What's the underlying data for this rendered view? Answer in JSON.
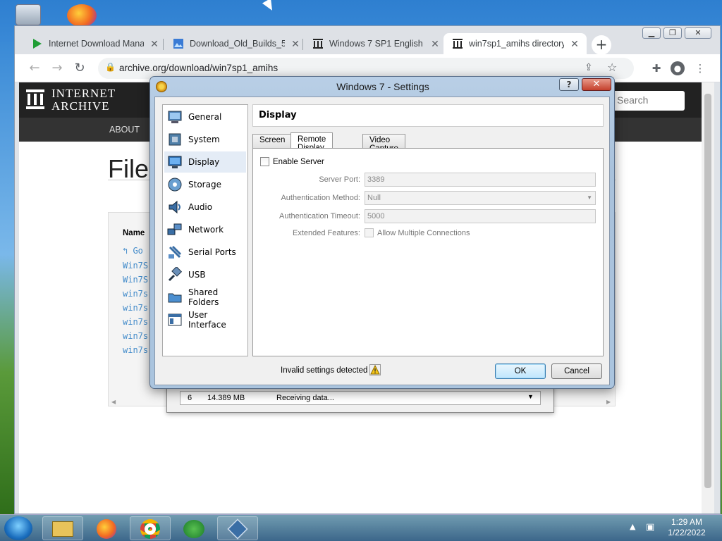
{
  "browser": {
    "tabs": [
      {
        "title": "Internet Download Mana",
        "icon": "idm-play-icon"
      },
      {
        "title": "Download_Old_Builds_5_",
        "icon": "image-icon"
      },
      {
        "title": "Windows 7 SP1 English E",
        "icon": "archive-icon"
      },
      {
        "title": "win7sp1_amihs directory",
        "icon": "archive-icon"
      }
    ],
    "new_tab": "+",
    "url": "archive.org/download/win7sp1_amihs"
  },
  "page": {
    "logo_line1": "INTERNET",
    "logo_line2": "ARCHIVE",
    "search_placeholder": "Search",
    "nav_about": "ABOUT",
    "title_partial": "File",
    "table_header": "Name",
    "go_up": "Go",
    "files": [
      "Win7S",
      "Win7S",
      "win7s",
      "win7s",
      "win7s",
      "win7s",
      "win7s"
    ]
  },
  "idm": {
    "num": "6",
    "size": "14.389 MB",
    "status": "Receiving data..."
  },
  "dialog": {
    "title": "Windows 7 - Settings",
    "help": "?",
    "close": "✕",
    "categories": [
      "General",
      "System",
      "Display",
      "Storage",
      "Audio",
      "Network",
      "Serial Ports",
      "USB",
      "Shared Folders",
      "User Interface"
    ],
    "selected_category": "Display",
    "pane_title": "Display",
    "tabs": [
      "Screen",
      "Remote Display",
      "Video Capture"
    ],
    "active_tab": "Remote Display",
    "enable_server_label": "Enable Server",
    "fields": {
      "server_port_label": "Server Port:",
      "server_port_value": "3389",
      "auth_method_label": "Authentication Method:",
      "auth_method_value": "Null",
      "auth_timeout_label": "Authentication Timeout:",
      "auth_timeout_value": "5000",
      "extended_label": "Extended Features:",
      "allow_multiple_label": "Allow Multiple Connections"
    },
    "status": "Invalid settings detected",
    "ok": "OK",
    "cancel": "Cancel"
  },
  "taskbar": {
    "time": "1:29 AM",
    "date": "1/22/2022"
  }
}
